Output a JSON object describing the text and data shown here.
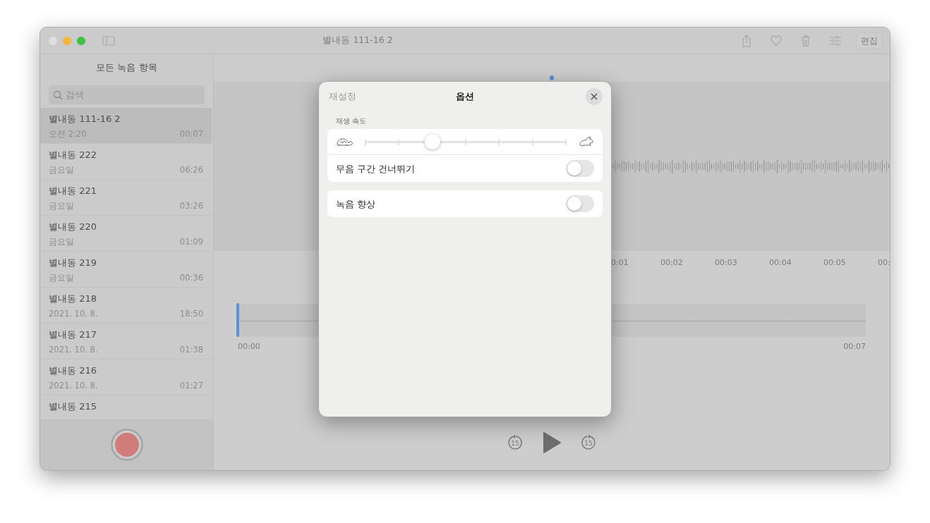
{
  "window": {
    "title": "별내동 111-16 2"
  },
  "toolbar": {
    "edit_button": "편집"
  },
  "sidebar": {
    "heading": "모든 녹음 항목",
    "search": {
      "placeholder": "검색"
    },
    "recordings": [
      {
        "name": "별내동 111-16 2",
        "date": "오전 2:20",
        "duration": "00:07",
        "selected": true
      },
      {
        "name": "별내동 222",
        "date": "금요일",
        "duration": "06:26",
        "selected": false
      },
      {
        "name": "별내동 221",
        "date": "금요일",
        "duration": "03:26",
        "selected": false
      },
      {
        "name": "별내동 220",
        "date": "금요일",
        "duration": "01:09",
        "selected": false
      },
      {
        "name": "별내동 219",
        "date": "금요일",
        "duration": "00:36",
        "selected": false
      },
      {
        "name": "별내동 218",
        "date": "2021. 10. 8.",
        "duration": "18:50",
        "selected": false
      },
      {
        "name": "별내동 217",
        "date": "2021. 10. 8.",
        "duration": "01:38",
        "selected": false
      },
      {
        "name": "별내동 216",
        "date": "2021. 10. 8.",
        "duration": "01:27",
        "selected": false
      },
      {
        "name": "별내동 215",
        "selected": false
      }
    ]
  },
  "player": {
    "ruler": [
      "0:01",
      "00:02",
      "00:03",
      "00:04",
      "00:05",
      "00:"
    ],
    "overview": {
      "start": "00:00",
      "end": "00:07"
    },
    "skip_back": "15",
    "skip_forward": "15"
  },
  "options_dialog": {
    "reset": "재설정",
    "title": "옵션",
    "speed_label": "재생 속도",
    "speed": {
      "level": 0.333
    },
    "toggles": [
      {
        "label": "무음 구간 건너뛰기",
        "on": false
      },
      {
        "label": "녹음 향상",
        "on": false
      }
    ]
  }
}
